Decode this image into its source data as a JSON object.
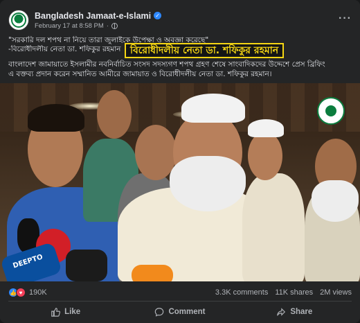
{
  "post": {
    "page_name": "Bangladesh Jamaat-e-Islami",
    "timestamp": "February 17 at 8:58 PM",
    "text_line_1": "\"সরকারি দল শপথ না নিয়ে তারা জুলাইকে উপেক্ষা ও অবজ্ঞা করেছে\"",
    "text_line_2": "-বিরোধীদলীয় নেতা ডা. শফিকুর রহমান",
    "highlight_caption": "বিরোধীদলীয় নেতা ডা. শফিকুর রহমান",
    "body_line_1": "বাংলাদেশ জামায়াতে ইসলামীর নবনির্বাচিত সংসদ সদস্যগণ শপথ গ্রহণ শেষে সাংবাদিকদের উদ্দেশে প্রেস ব্রিফিং",
    "body_line_2": "এ বক্তব্য প্রদান করেন সম্মানিত আমীরে জামায়াত ও বিরোধীদলীয় নেতা ডা. শফিকুর রহমান।"
  },
  "media": {
    "mic_label": "DEEPTO"
  },
  "engagement": {
    "reaction_count": "190K",
    "comments": "3.3K comments",
    "shares": "11K shares",
    "views": "2M views"
  },
  "actions": {
    "like": "Like",
    "comment": "Comment",
    "share": "Share"
  },
  "icons": {
    "verified": "verified-badge-icon",
    "globe": "globe-icon",
    "more": "more-options-icon",
    "like_reaction": "like-reaction-icon",
    "love_reaction": "love-reaction-icon"
  },
  "colors": {
    "background": "#242526",
    "text": "#e4e6eb",
    "secondary_text": "#b0b3b8",
    "accent": "#2d88ff",
    "caption_highlight": "#f5d614"
  }
}
